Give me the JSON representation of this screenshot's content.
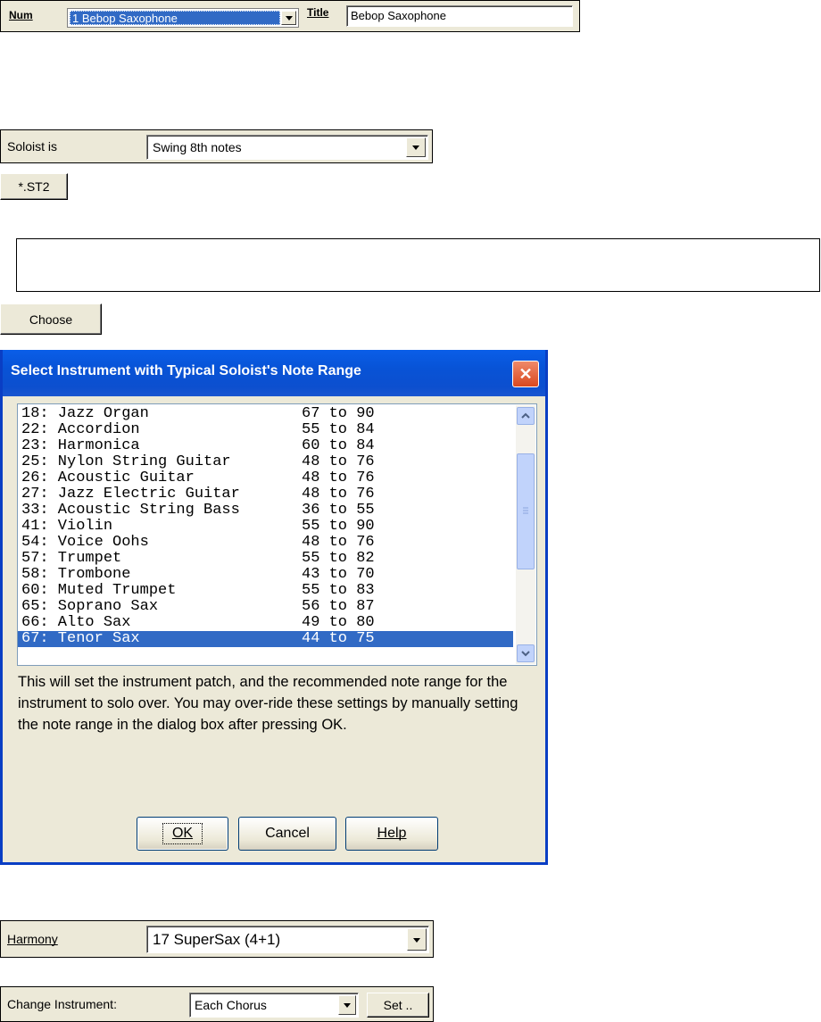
{
  "num_row": {
    "num_label": "Num",
    "num_value": "1 Bebop Saxophone",
    "title_label": "Title",
    "title_value": "Bebop Saxophone"
  },
  "soloist_row": {
    "label": "Soloist is",
    "value": "Swing 8th notes"
  },
  "st2_button": {
    "label": "*.ST2"
  },
  "empty_box": {
    "text": ""
  },
  "choose_button": {
    "label": "Choose"
  },
  "dialog": {
    "title": "Select Instrument with Typical Soloist's Note Range",
    "list": [
      {
        "name": "18: Jazz Organ",
        "range": "67 to 90"
      },
      {
        "name": "22: Accordion",
        "range": "55 to 84"
      },
      {
        "name": "23: Harmonica",
        "range": "60 to 84"
      },
      {
        "name": "25: Nylon String Guitar",
        "range": "48 to 76"
      },
      {
        "name": "26: Acoustic Guitar",
        "range": "48 to 76"
      },
      {
        "name": "27: Jazz Electric Guitar",
        "range": "48 to 76"
      },
      {
        "name": "33: Acoustic String Bass",
        "range": "36 to 55"
      },
      {
        "name": "41: Violin",
        "range": "55 to 90"
      },
      {
        "name": "54: Voice Oohs",
        "range": "48 to 76"
      },
      {
        "name": "57: Trumpet",
        "range": "55 to 82"
      },
      {
        "name": "58: Trombone",
        "range": "43 to 70"
      },
      {
        "name": "60: Muted Trumpet",
        "range": "55 to 83"
      },
      {
        "name": "65: Soprano Sax",
        "range": "56 to 87"
      },
      {
        "name": "66: Alto Sax",
        "range": "49 to 80"
      },
      {
        "name": "67: Tenor Sax",
        "range": "44 to 75"
      }
    ],
    "selected_index": 14,
    "description": "This will set the instrument patch, and the recommended note range for the instrument to solo over. You may over-ride these settings by manually setting the note range in the dialog box after pressing OK.",
    "ok_label": "OK",
    "cancel_label": "Cancel",
    "help_label": "Help"
  },
  "harmony_row": {
    "label": "Harmony",
    "value": "17 SuperSax (4+1)"
  },
  "change_row": {
    "label": "Change Instrument:",
    "value": "Each Chorus",
    "set_label": "Set .."
  },
  "colors": {
    "selection": "#316ac5",
    "dialog_title": "#0a5ee8",
    "panel": "#ece9d8"
  }
}
